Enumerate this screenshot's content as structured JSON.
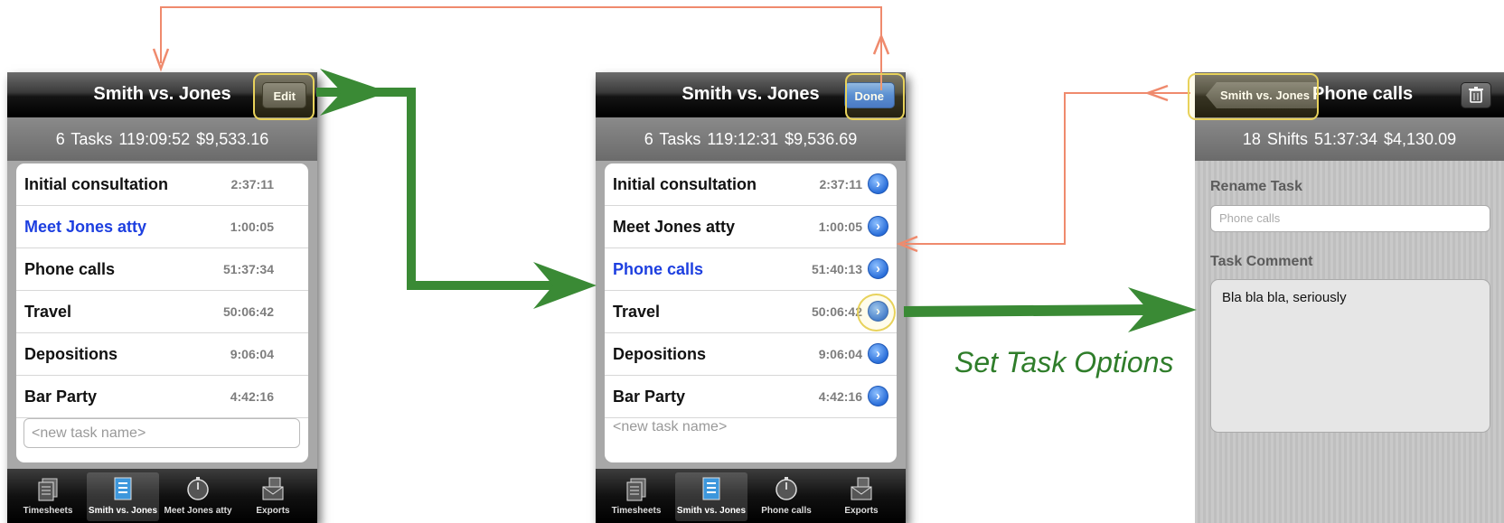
{
  "caption": "Set Task Options",
  "colors": {
    "green_arrow": "#3a8a35",
    "orange_arrow": "#ef8a6d",
    "highlight": "#e8d25b",
    "selected_text": "#1d3fe0"
  },
  "screen1": {
    "title": "Smith vs. Jones",
    "edit_label": "Edit",
    "summary": "6 Tasks  119:09:52   $9,533.16",
    "tasks": [
      {
        "name": "Initial consultation",
        "time": "2:37:11"
      },
      {
        "name": "Meet Jones atty",
        "time": "1:00:05"
      },
      {
        "name": "Phone calls",
        "time": "51:37:34"
      },
      {
        "name": "Travel",
        "time": "50:06:42"
      },
      {
        "name": "Depositions",
        "time": "9:06:04"
      },
      {
        "name": "Bar Party",
        "time": "4:42:16"
      }
    ],
    "new_task_placeholder": "<new task name>",
    "tabs": [
      {
        "label": "Timesheets",
        "icon": "timesheets-icon"
      },
      {
        "label": "Smith vs. Jones",
        "icon": "task-list-icon"
      },
      {
        "label": "Meet Jones atty",
        "icon": "stopwatch-icon"
      },
      {
        "label": "Exports",
        "icon": "exports-icon"
      }
    ]
  },
  "screen2": {
    "title": "Smith vs. Jones",
    "done_label": "Done",
    "summary": "6 Tasks  119:12:31   $9,536.69",
    "tasks": [
      {
        "name": "Initial consultation",
        "time": "2:37:11"
      },
      {
        "name": "Meet Jones atty",
        "time": "1:00:05"
      },
      {
        "name": "Phone calls",
        "time": "51:40:13"
      },
      {
        "name": "Travel",
        "time": "50:06:42"
      },
      {
        "name": "Depositions",
        "time": "9:06:04"
      },
      {
        "name": "Bar Party",
        "time": "4:42:16"
      }
    ],
    "new_task_placeholder": "<new task name>",
    "tabs": [
      {
        "label": "Timesheets",
        "icon": "timesheets-icon"
      },
      {
        "label": "Smith vs. Jones",
        "icon": "task-list-icon"
      },
      {
        "label": "Phone calls",
        "icon": "stopwatch-icon"
      },
      {
        "label": "Exports",
        "icon": "exports-icon"
      }
    ]
  },
  "screen3": {
    "back_label": "Smith vs. Jones",
    "title": "Phone calls",
    "summary": "18 Shifts  51:37:34    $4,130.09",
    "rename_label": "Rename Task",
    "rename_placeholder": "Phone calls",
    "comment_label": "Task Comment",
    "comment_value": "Bla bla bla, seriously"
  }
}
